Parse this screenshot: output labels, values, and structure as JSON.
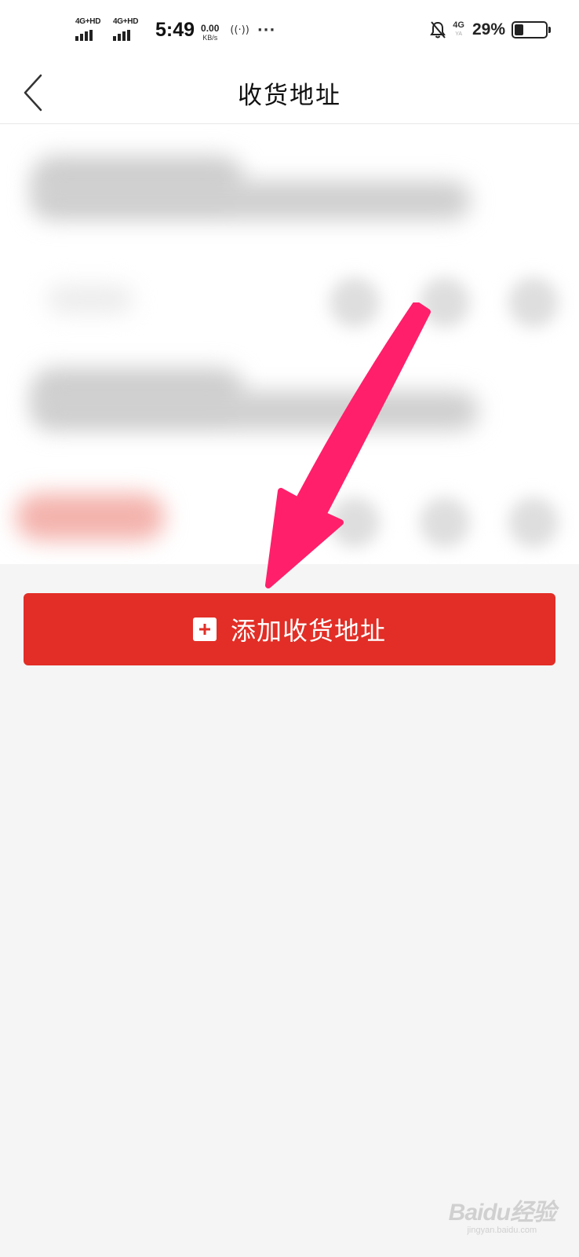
{
  "status_bar": {
    "network1": "4G+HD",
    "network2": "4G+HD",
    "time": "5:49",
    "speed_value": "0.00",
    "speed_unit": "KB/s",
    "hotspot": "((·))",
    "more": "···",
    "network3": "4G",
    "network3_sub": "YA",
    "battery_percent": "29%",
    "battery_level": 0.29
  },
  "header": {
    "title": "收货地址"
  },
  "main": {
    "add_address_label": "添加收货地址"
  },
  "colors": {
    "primary_red": "#e22e26",
    "arrow": "#ff1f6b",
    "background": "#f5f5f5"
  },
  "watermark": {
    "main": "Baidu经验",
    "sub": "jingyan.baidu.com"
  }
}
